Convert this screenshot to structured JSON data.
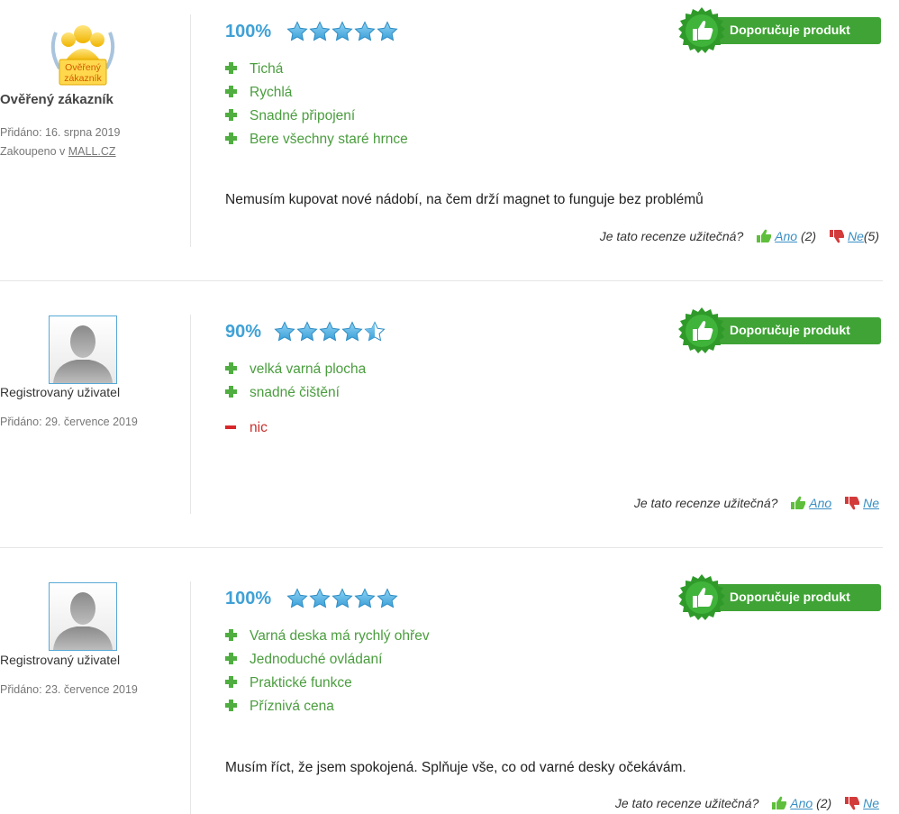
{
  "labels": {
    "recommend": "Doporučuje produkt",
    "helpful_question": "Je tato recenze užitečná?",
    "yes": "Ano",
    "no": "Ne",
    "verified_badge_line1": "Ověřený",
    "verified_badge_line2": "zákazník"
  },
  "colors": {
    "accent_blue": "#3fa1d6",
    "pro_green": "#4a9d3e",
    "con_red": "#c9302c",
    "recommend_green": "#3fa435"
  },
  "reviews": [
    {
      "author": "Ověřený zákazník",
      "avatar_icon": "verified-customer-badge-icon",
      "added": "Přidáno: 16. srpna 2019",
      "bought_prefix": "Zakoupeno v",
      "bought_store": "MALL.CZ",
      "score": "100%",
      "rating_stars": 5,
      "pros": [
        "Tichá",
        "Rychlá",
        "Snadné připojení",
        "Bere všechny staré hrnce"
      ],
      "cons": [],
      "text": "Nemusím kupovat nové nádobí, na čem drží magnet to funguje bez problémů",
      "yes_count": "(2)",
      "no_count": "(5)"
    },
    {
      "author": "Registrovaný uživatel",
      "avatar_icon": "user-avatar-placeholder-icon",
      "added": "Přidáno: 29. července 2019",
      "score": "90%",
      "rating_stars": 4.5,
      "pros": [
        "velká varná plocha",
        "snadné čištění"
      ],
      "cons": [
        "nic"
      ],
      "text": "",
      "yes_count": "",
      "no_count": ""
    },
    {
      "author": "Registrovaný uživatel",
      "avatar_icon": "user-avatar-placeholder-icon",
      "added": "Přidáno: 23. července 2019",
      "score": "100%",
      "rating_stars": 5,
      "pros": [
        "Varná deska má rychlý ohřev",
        "Jednoduché ovládaní",
        "Praktické funkce",
        "Příznivá cena"
      ],
      "cons": [],
      "text": "Musím říct, že jsem spokojená. Splňuje vše, co od varné desky očekávám.",
      "yes_count": "(2)",
      "no_count": ""
    }
  ]
}
